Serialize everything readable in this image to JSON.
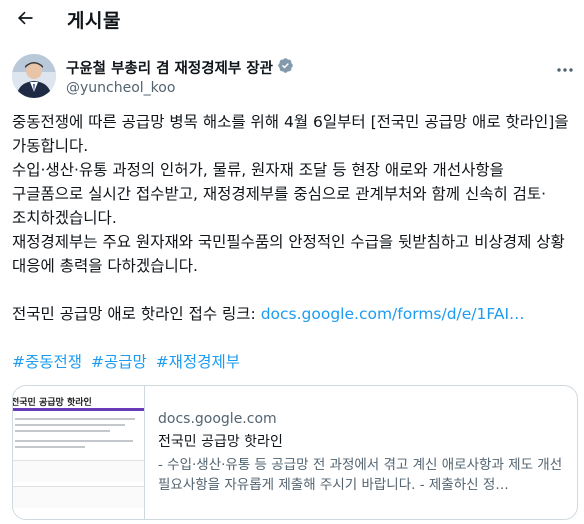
{
  "header": {
    "back_icon": "arrow-left-icon",
    "title": "게시물"
  },
  "author": {
    "display_name": "구윤철 부총리 겸 재정경제부 장관",
    "handle": "@yuncheol_koo",
    "verified_icon": "verified-badge-icon",
    "verified_color": "#829aab"
  },
  "post": {
    "paragraph1": "중동전쟁에 따른 공급망 병목 해소를 위해 4월 6일부터 [전국민 공급망 애로 핫라인]을 가동합니다.",
    "paragraph2": "수입·생산·유통 과정의 인허가, 물류, 원자재 조달 등 현장 애로와 개선사항을 구글폼으로 실시간 접수받고, 재정경제부를 중심으로 관계부처와 함께 신속히 검토·조치하겠습니다.",
    "paragraph3": "재정경제부는 주요 원자재와 국민필수품의 안정적인 수급을 뒷받침하고 비상경제 상황 대응에 총력을 다하겠습니다.",
    "link_prefix": "전국민 공급망 애로 핫라인 접수 링크: ",
    "link_text": "docs.google.com/forms/d/e/1FAI…",
    "hashtags": [
      "#중동전쟁",
      "#공급망",
      "#재정경제부"
    ]
  },
  "link_card": {
    "thumb_title": "전국민 공급망 핫라인",
    "domain": "docs.google.com",
    "title": "전국민 공급망 핫라인",
    "description": "- 수입·생산·유통 등 공급망 전 과정에서 겪고 계신 애로사항과 제도 개선 필요사항을 자유롭게 제출해 주시기 바랍니다. - 제출하신 정…"
  },
  "colors": {
    "link": "#1d9bf0",
    "secondary_text": "#536471",
    "border": "#cfd9de",
    "forms_accent": "#673ab7"
  }
}
